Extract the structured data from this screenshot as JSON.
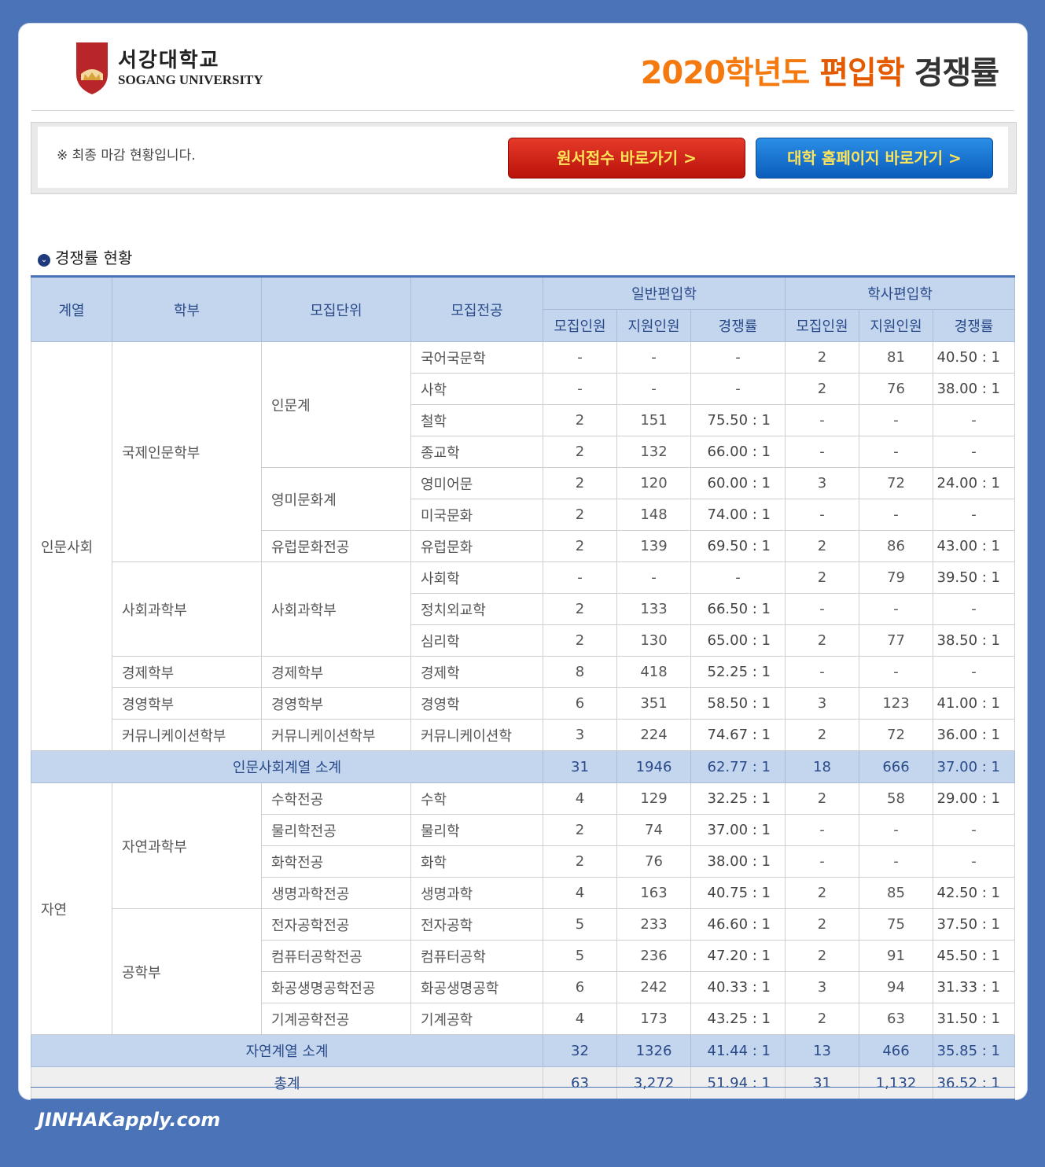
{
  "header": {
    "logo_ko": "서강대학교",
    "logo_en": "SOGANG UNIVERSITY",
    "logo_badge": "IHS",
    "title_year": "2020학년도",
    "title_type": "편입학",
    "title_rate": "경쟁률"
  },
  "notice": {
    "text": "※ 최종 마감 현황입니다.",
    "btn_apply": "원서접수 바로가기 >",
    "btn_home": "대학 홈페이지 바로가기 >"
  },
  "section_title": "경쟁률 현황",
  "table": {
    "headers": {
      "field": "계열",
      "school": "학부",
      "unit": "모집단위",
      "major": "모집전공",
      "general": "일반편입학",
      "bachelor": "학사편입학",
      "quota": "모집인원",
      "applicants": "지원인원",
      "rate": "경쟁률"
    },
    "rows": [
      [
        "인문사회",
        "국제인문학부",
        "인문계",
        "국어국문학",
        "-",
        "-",
        "-",
        "2",
        "81",
        "40.50 : 1"
      ],
      [
        "",
        "",
        "",
        "사학",
        "-",
        "-",
        "-",
        "2",
        "76",
        "38.00 : 1"
      ],
      [
        "",
        "",
        "",
        "철학",
        "2",
        "151",
        "75.50 : 1",
        "-",
        "-",
        "-"
      ],
      [
        "",
        "",
        "",
        "종교학",
        "2",
        "132",
        "66.00 : 1",
        "-",
        "-",
        "-"
      ],
      [
        "",
        "",
        "영미문화계",
        "영미어문",
        "2",
        "120",
        "60.00 : 1",
        "3",
        "72",
        "24.00 : 1"
      ],
      [
        "",
        "",
        "",
        "미국문화",
        "2",
        "148",
        "74.00 : 1",
        "-",
        "-",
        "-"
      ],
      [
        "",
        "",
        "유럽문화전공",
        "유럽문화",
        "2",
        "139",
        "69.50 : 1",
        "2",
        "86",
        "43.00 : 1"
      ],
      [
        "",
        "사회과학부",
        "사회과학부",
        "사회학",
        "-",
        "-",
        "-",
        "2",
        "79",
        "39.50 : 1"
      ],
      [
        "",
        "",
        "",
        "정치외교학",
        "2",
        "133",
        "66.50 : 1",
        "-",
        "-",
        "-"
      ],
      [
        "",
        "",
        "",
        "심리학",
        "2",
        "130",
        "65.00 : 1",
        "2",
        "77",
        "38.50 : 1"
      ],
      [
        "",
        "경제학부",
        "경제학부",
        "경제학",
        "8",
        "418",
        "52.25 : 1",
        "-",
        "-",
        "-"
      ],
      [
        "",
        "경영학부",
        "경영학부",
        "경영학",
        "6",
        "351",
        "58.50 : 1",
        "3",
        "123",
        "41.00 : 1"
      ],
      [
        "",
        "커뮤니케이션학부",
        "커뮤니케이션학부",
        "커뮤니케이션학",
        "3",
        "224",
        "74.67 : 1",
        "2",
        "72",
        "36.00 : 1"
      ],
      [
        "자연",
        "자연과학부",
        "수학전공",
        "수학",
        "4",
        "129",
        "32.25 : 1",
        "2",
        "58",
        "29.00 : 1"
      ],
      [
        "",
        "",
        "물리학전공",
        "물리학",
        "2",
        "74",
        "37.00 : 1",
        "-",
        "-",
        "-"
      ],
      [
        "",
        "",
        "화학전공",
        "화학",
        "2",
        "76",
        "38.00 : 1",
        "-",
        "-",
        "-"
      ],
      [
        "",
        "",
        "생명과학전공",
        "생명과학",
        "4",
        "163",
        "40.75 : 1",
        "2",
        "85",
        "42.50 : 1"
      ],
      [
        "",
        "공학부",
        "전자공학전공",
        "전자공학",
        "5",
        "233",
        "46.60 : 1",
        "2",
        "75",
        "37.50 : 1"
      ],
      [
        "",
        "",
        "컴퓨터공학전공",
        "컴퓨터공학",
        "5",
        "236",
        "47.20 : 1",
        "2",
        "91",
        "45.50 : 1"
      ],
      [
        "",
        "",
        "화공생명공학전공",
        "화공생명공학",
        "6",
        "242",
        "40.33 : 1",
        "3",
        "94",
        "31.33 : 1"
      ],
      [
        "",
        "",
        "기계공학전공",
        "기계공학",
        "4",
        "173",
        "43.25 : 1",
        "2",
        "63",
        "31.50 : 1"
      ]
    ],
    "subtotal_humanities": [
      "인문사회계열 소계",
      "31",
      "1946",
      "62.77 : 1",
      "18",
      "666",
      "37.00 : 1"
    ],
    "subtotal_natural": [
      "자연계열 소계",
      "32",
      "1326",
      "41.44 : 1",
      "13",
      "466",
      "35.85 : 1"
    ],
    "total": [
      "총계",
      "63",
      "3,272",
      "51.94 : 1",
      "31",
      "1,132",
      "36.52 : 1"
    ]
  },
  "footer_brand": "JINHAKapply.com"
}
